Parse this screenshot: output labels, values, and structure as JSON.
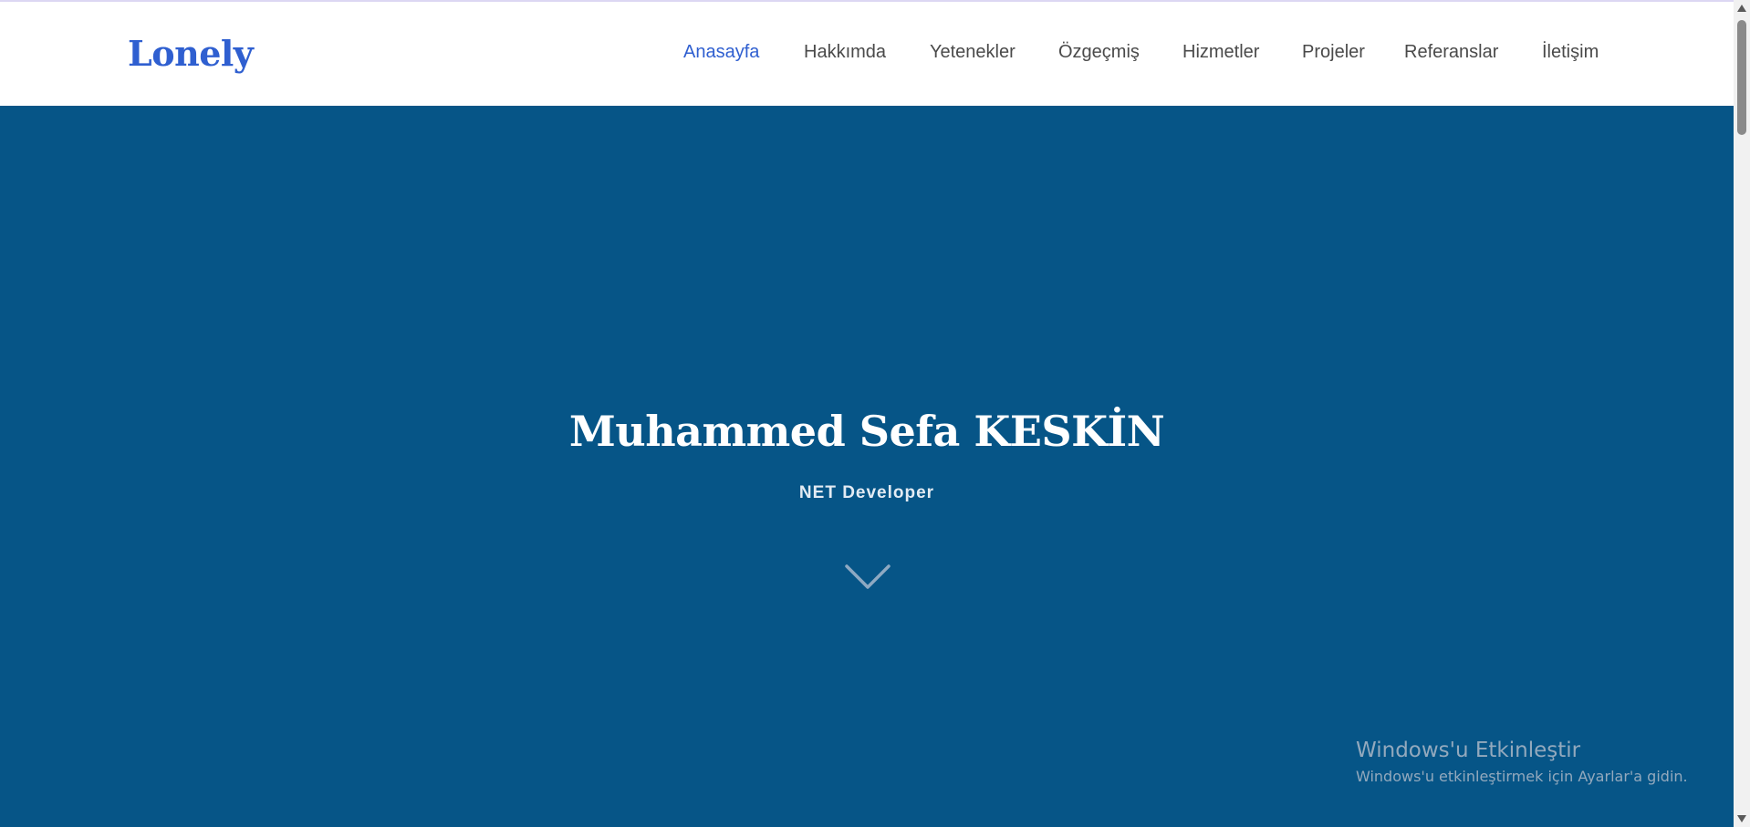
{
  "header": {
    "logo": "Lonely",
    "nav": [
      {
        "label": "Anasayfa",
        "active": true
      },
      {
        "label": "Hakkımda",
        "active": false
      },
      {
        "label": "Yetenekler",
        "active": false
      },
      {
        "label": "Özgeçmiş",
        "active": false
      },
      {
        "label": "Hizmetler",
        "active": false
      },
      {
        "label": "Projeler",
        "active": false
      },
      {
        "label": "Referanslar",
        "active": false
      },
      {
        "label": "İletişim",
        "active": false
      }
    ]
  },
  "hero": {
    "title": "Muhammed Sefa KESKİN",
    "subtitle": "NET Developer",
    "scroll_icon": "chevron-down-icon"
  },
  "windows_activation": {
    "title": "Windows'u Etkinleştir",
    "message": "Windows'u etkinleştirmek için Ayarlar'a gidin."
  },
  "colors": {
    "accent": "#2f5fd0",
    "hero_bg": "#065587",
    "nav_text": "#4a4a4a"
  }
}
